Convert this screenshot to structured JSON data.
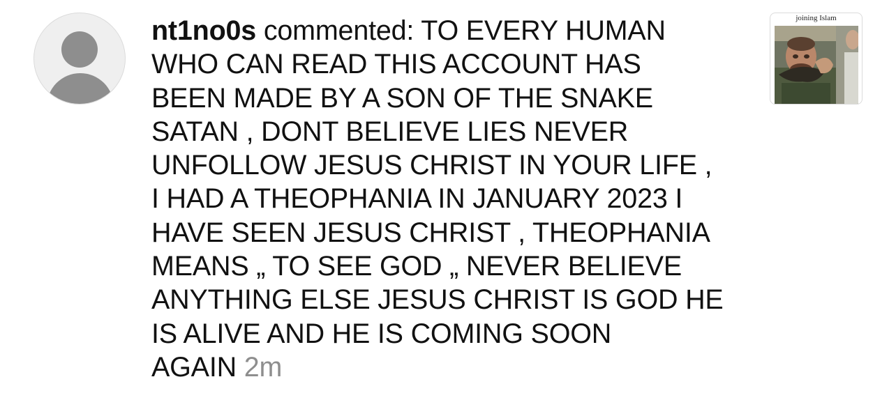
{
  "notification": {
    "username": "nt1no0s",
    "action": " commented: ",
    "comment_lines": [
      "TO EVERY HUMAN",
      "WHO CAN READ THIS ACCOUNT HAS",
      "BEEN MADE BY A SON OF THE SNAKE",
      "SATAN , DONT BELIEVE LIES NEVER",
      "UNFOLLOW JESUS CHRIST IN YOUR LIFE ,",
      "I HAD A THEOPHANIA IN JANUARY 2023 I",
      "HAVE SEEN JESUS CHRIST , THEOPHANIA",
      "MEANS „ TO SEE GOD „ NEVER BELIEVE",
      "ANYTHING ELSE JESUS CHRIST IS GOD HE",
      "IS ALIVE AND HE IS COMING SOON",
      "AGAIN"
    ],
    "timestamp": "2m"
  },
  "avatar": {
    "icon": "default-user-avatar-icon"
  },
  "post_thumbnail": {
    "caption": "joining Islam"
  },
  "colors": {
    "text": "#111111",
    "timestamp": "#8e8e8e",
    "avatar_bg": "#efefef",
    "avatar_glyph": "#8e8e8e",
    "border": "#dbdbdb"
  }
}
